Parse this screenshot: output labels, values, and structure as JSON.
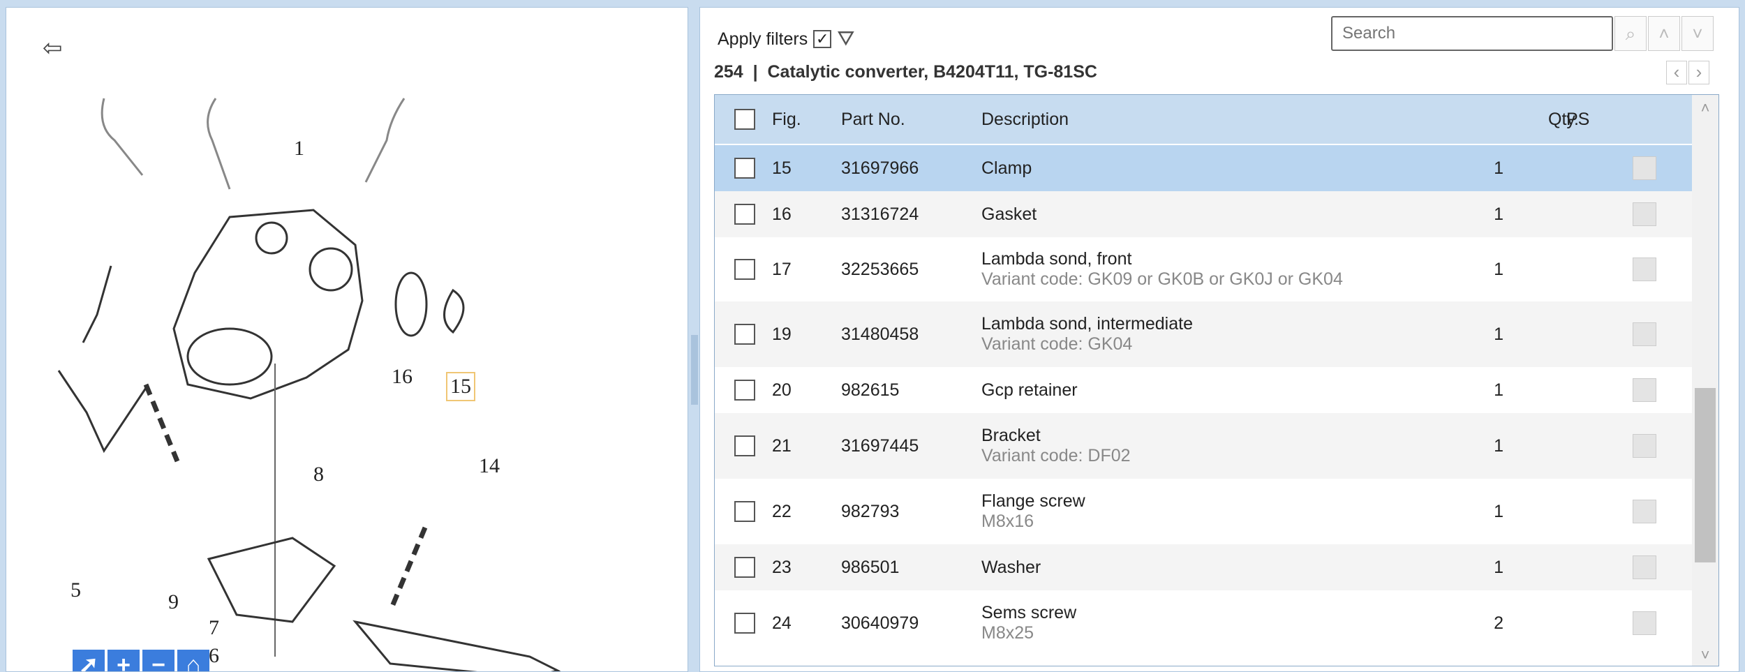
{
  "diagram": {
    "callouts": [
      "1",
      "16",
      "15",
      "14",
      "8",
      "9",
      "5",
      "7",
      "6"
    ],
    "highlighted": "15"
  },
  "toolbar": {
    "apply_filters": "Apply filters",
    "apply_filters_checked": true,
    "search_placeholder": "Search"
  },
  "section": {
    "title": "254  |  Catalytic converter, B4204T11, TG-81SC"
  },
  "table": {
    "headers": {
      "fig": "Fig.",
      "part": "Part No.",
      "desc": "Description",
      "qty": "Qty.",
      "ps": "PS"
    },
    "rows": [
      {
        "fig": "15",
        "part": "31697966",
        "desc": "Clamp",
        "variant": "",
        "qty": "1",
        "selected": true
      },
      {
        "fig": "16",
        "part": "31316724",
        "desc": "Gasket",
        "variant": "",
        "qty": "1"
      },
      {
        "fig": "17",
        "part": "32253665",
        "desc": "Lambda sond, front",
        "variant": "Variant code: GK09 or GK0B or GK0J or GK04",
        "qty": "1"
      },
      {
        "fig": "19",
        "part": "31480458",
        "desc": "Lambda sond, intermediate",
        "variant": "Variant code: GK04",
        "qty": "1"
      },
      {
        "fig": "20",
        "part": "982615",
        "desc": "Gcp retainer",
        "variant": "",
        "qty": "1"
      },
      {
        "fig": "21",
        "part": "31697445",
        "desc": "Bracket",
        "variant": "Variant code: DF02",
        "qty": "1"
      },
      {
        "fig": "22",
        "part": "982793",
        "desc": "Flange screw",
        "variant": "M8x16",
        "qty": "1"
      },
      {
        "fig": "23",
        "part": "986501",
        "desc": "Washer",
        "variant": "",
        "qty": "1"
      },
      {
        "fig": "24",
        "part": "30640979",
        "desc": "Sems screw",
        "variant": "M8x25",
        "qty": "2"
      }
    ]
  },
  "colors": {
    "selected_row": "#b9d5f0",
    "header": "#c7dcf0",
    "zoom_button": "#3b7ddd"
  }
}
